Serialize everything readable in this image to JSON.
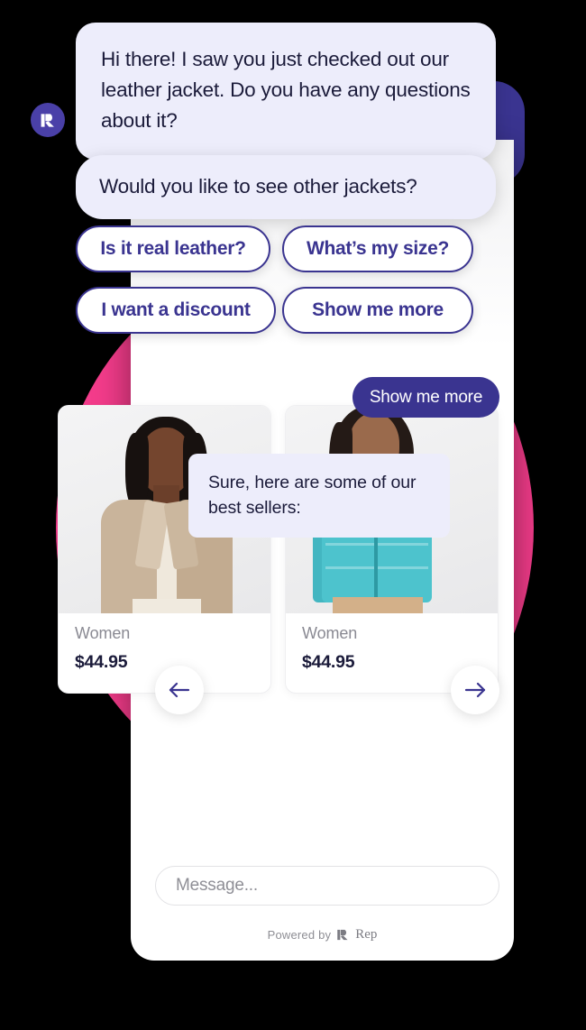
{
  "colors": {
    "background": "#000000",
    "pink_accent": "#F43C8B",
    "purple_accent": "#3A3490",
    "panel": "#FFFFFF",
    "bot_bubble": "#EDEDFB",
    "bot_text": "#1B1B3A",
    "user_bubble": "#3A3490",
    "user_text": "#FFFFFF",
    "pill_border": "#3A3490",
    "pill_text": "#3A3490",
    "muted_text": "#8A8A93"
  },
  "avatar": {
    "logo_letter": "R",
    "icon_name": "rep-logo-icon"
  },
  "messages": [
    {
      "id": "bubble1",
      "sender": "bot",
      "text": "Hi there! I saw you just checked out our leather jacket. Do you have any questions about it?"
    },
    {
      "id": "bubble2",
      "sender": "bot",
      "text": "Would you like to see other jackets?"
    },
    {
      "id": "bubble-user",
      "sender": "user",
      "text": "Show me more"
    },
    {
      "id": "bubble3",
      "sender": "bot",
      "text": "Sure, here are some of our best sellers:"
    }
  ],
  "quick_replies": [
    {
      "label": "Is it real leather?"
    },
    {
      "label": "What’s my size?"
    },
    {
      "label": "I want a discount"
    },
    {
      "label": "Show me more"
    }
  ],
  "carousel": {
    "prev_icon": "arrow-left-icon",
    "next_icon": "arrow-right-icon",
    "products": [
      {
        "category": "Women",
        "price": "$44.95",
        "image_alt": "tan-leather-moto-jacket"
      },
      {
        "category": "Women",
        "price": "$44.95",
        "image_alt": "teal-puffer-jacket"
      }
    ]
  },
  "composer": {
    "placeholder": "Message...",
    "value": ""
  },
  "footer": {
    "powered_by": "Powered by",
    "brand": "Rep",
    "logo_icon": "rep-mark-icon"
  }
}
